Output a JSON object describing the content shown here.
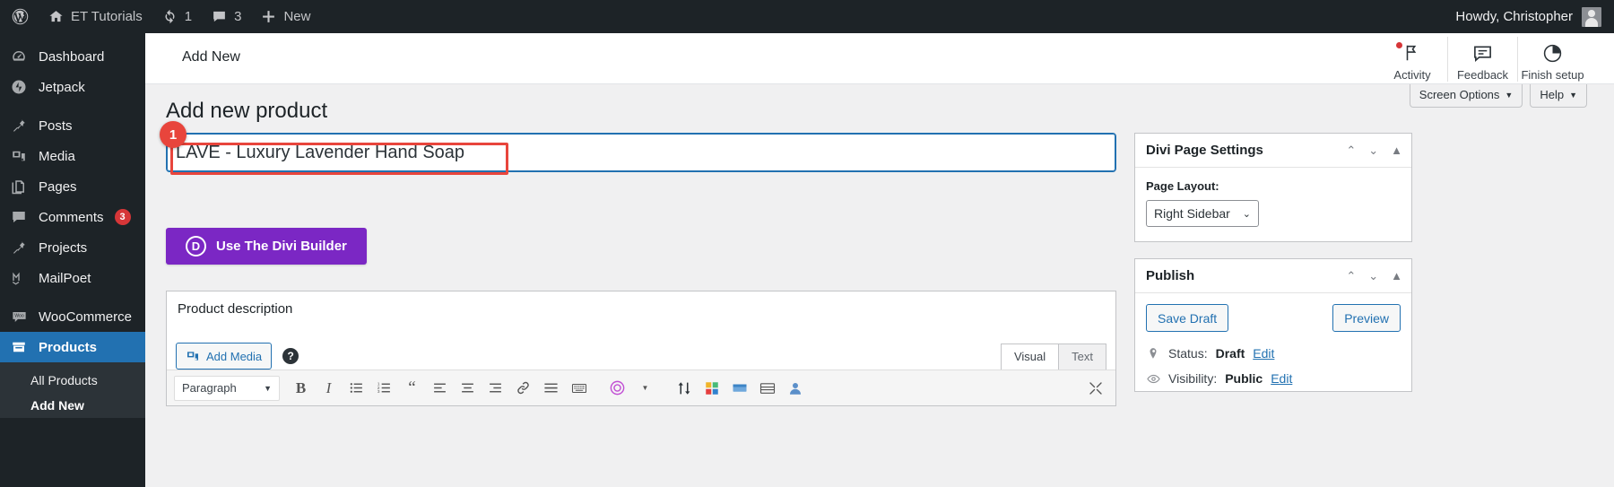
{
  "adminbar": {
    "logo_icon": "wordpress-icon",
    "site": {
      "icon": "home-icon",
      "label": "ET Tutorials"
    },
    "updates": {
      "icon": "updates-icon",
      "count": "1"
    },
    "comments": {
      "icon": "comment-icon",
      "count": "3"
    },
    "new": {
      "icon": "plus-icon",
      "label": "New"
    },
    "howdy": "Howdy, Christopher"
  },
  "sidebar": {
    "items": [
      {
        "label": "Dashboard",
        "icon": "dashboard-icon",
        "current": false,
        "count": ""
      },
      {
        "label": "Jetpack",
        "icon": "jetpack-icon",
        "current": false,
        "count": ""
      },
      {
        "label": "Posts",
        "icon": "pin-icon",
        "current": false,
        "count": ""
      },
      {
        "label": "Media",
        "icon": "media-icon",
        "current": false,
        "count": ""
      },
      {
        "label": "Pages",
        "icon": "pages-icon",
        "current": false,
        "count": ""
      },
      {
        "label": "Comments",
        "icon": "comment-icon",
        "current": false,
        "count": "3"
      },
      {
        "label": "Projects",
        "icon": "pin-icon",
        "current": false,
        "count": ""
      },
      {
        "label": "MailPoet",
        "icon": "mailpoet-icon",
        "current": false,
        "count": ""
      },
      {
        "label": "WooCommerce",
        "icon": "woocommerce-icon",
        "current": false,
        "count": ""
      },
      {
        "label": "Products",
        "icon": "products-icon",
        "current": true,
        "count": ""
      }
    ],
    "submenu": [
      {
        "label": "All Products",
        "current": false
      },
      {
        "label": "Add New",
        "current": true
      }
    ]
  },
  "wpbar": {
    "title": "Add New",
    "actions": [
      {
        "label": "Activity",
        "icon": "flag-icon",
        "badge": true
      },
      {
        "label": "Feedback",
        "icon": "speech-bubble-icon",
        "badge": false
      },
      {
        "label": "Finish setup",
        "icon": "progress-circle-icon",
        "badge": false
      }
    ],
    "screen_options": "Screen Options",
    "help": "Help",
    "caret": "▼"
  },
  "main": {
    "page_title": "Add new product",
    "product_title_value": "LAVE - Luxury Lavender Hand Soap",
    "product_title_placeholder": "Product name",
    "annotation_number": "1",
    "divi_button": {
      "label": "Use The Divi Builder",
      "glyph": "D",
      "color": "#7b27c4"
    },
    "description_box": {
      "heading": "Product description",
      "add_media": "Add Media",
      "help_glyph": "?",
      "tabs": [
        {
          "label": "Visual",
          "active": true
        },
        {
          "label": "Text",
          "active": false
        }
      ],
      "format_select": "Paragraph",
      "format_caret": "▼",
      "toolbar": [
        {
          "name": "bold-icon",
          "glyph": "B"
        },
        {
          "name": "italic-icon",
          "glyph": "I"
        },
        {
          "name": "bulleted-list-icon",
          "glyph": ""
        },
        {
          "name": "numbered-list-icon",
          "glyph": ""
        },
        {
          "name": "blockquote-icon",
          "glyph": "❝"
        },
        {
          "name": "align-left-icon",
          "glyph": ""
        },
        {
          "name": "align-center-icon",
          "glyph": ""
        },
        {
          "name": "align-right-icon",
          "glyph": ""
        },
        {
          "name": "link-icon",
          "glyph": ""
        },
        {
          "name": "read-more-icon",
          "glyph": ""
        },
        {
          "name": "keyboard-icon",
          "glyph": ""
        },
        {
          "name": "divi-module-icon",
          "glyph": ""
        },
        {
          "name": "toolbar-toggle-icon",
          "glyph": ""
        },
        {
          "name": "color-grid-icon",
          "glyph": ""
        },
        {
          "name": "table-icon",
          "glyph": ""
        },
        {
          "name": "layout-icon",
          "glyph": ""
        },
        {
          "name": "person-icon",
          "glyph": ""
        },
        {
          "name": "fullscreen-icon",
          "glyph": ""
        }
      ]
    }
  },
  "side": {
    "divi_settings": {
      "title": "Divi Page Settings",
      "controls": [
        "⌃",
        "⌄",
        "▲"
      ],
      "page_layout_label": "Page Layout:",
      "page_layout_value": "Right Sidebar",
      "select_caret": "⌄"
    },
    "publish": {
      "title": "Publish",
      "controls": [
        "⌃",
        "⌄",
        "▲"
      ],
      "save_draft": "Save Draft",
      "preview": "Preview",
      "status_label": "Status:",
      "status_value": "Draft",
      "status_edit": "Edit",
      "visibility_label": "Visibility:",
      "visibility_value": "Public",
      "visibility_edit": "Edit"
    }
  }
}
